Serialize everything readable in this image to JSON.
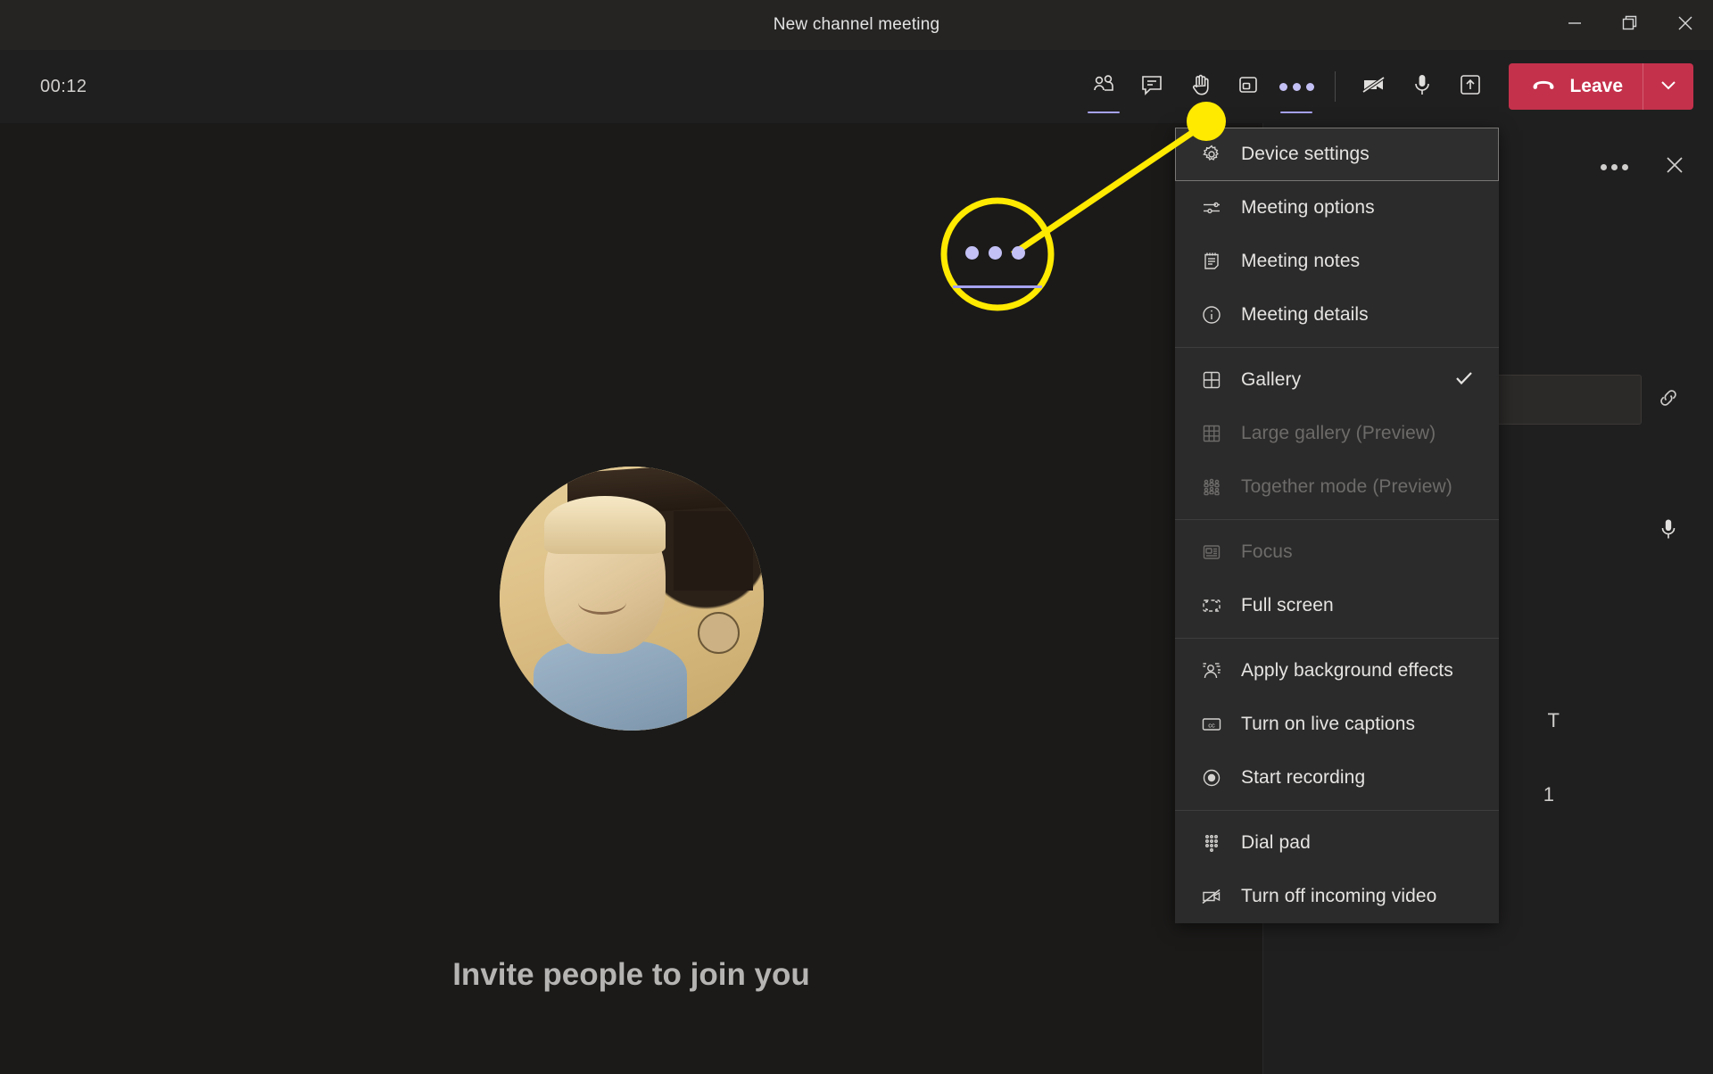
{
  "window": {
    "title": "New channel meeting",
    "controls": [
      {
        "name": "minimize",
        "glyph": "minimize-icon"
      },
      {
        "name": "restore",
        "glyph": "restore-icon"
      },
      {
        "name": "close",
        "glyph": "close-icon"
      }
    ]
  },
  "toolbar": {
    "timer": "00:12",
    "buttons": [
      {
        "name": "show-participants",
        "icon": "people-icon",
        "active": true
      },
      {
        "name": "show-conversation",
        "icon": "chat-icon",
        "active": false
      },
      {
        "name": "raise-hand",
        "icon": "hand-icon",
        "active": false
      },
      {
        "name": "breakout-rooms",
        "icon": "rooms-icon",
        "active": false
      },
      {
        "name": "more-actions",
        "icon": "ellipsis-icon",
        "active": true
      },
      {
        "name": "camera-off",
        "icon": "camera-off-icon",
        "active": false
      },
      {
        "name": "microphone",
        "icon": "microphone-icon",
        "active": false
      },
      {
        "name": "share-content",
        "icon": "share-tray-icon",
        "active": false
      }
    ],
    "leave_label": "Leave"
  },
  "stage": {
    "invite_text": "Invite people to join you",
    "avatar_name": "participant-avatar"
  },
  "right_panel": {
    "more_options": "panel-ellipsis",
    "close": "panel-close",
    "search_placeholder": "",
    "link_icon": "copy-link-icon",
    "mic_icon": "microphone-icon",
    "ghost_text_1": "T",
    "ghost_text_2": "1"
  },
  "context_menu": {
    "groups": [
      {
        "items": [
          {
            "label": "Device settings",
            "icon": "gear-icon",
            "disabled": false,
            "checked": false,
            "focused": true
          },
          {
            "label": "Meeting options",
            "icon": "sliders-icon",
            "disabled": false,
            "checked": false,
            "focused": false
          },
          {
            "label": "Meeting notes",
            "icon": "notepad-icon",
            "disabled": false,
            "checked": false,
            "focused": false
          },
          {
            "label": "Meeting details",
            "icon": "info-icon",
            "disabled": false,
            "checked": false,
            "focused": false
          }
        ]
      },
      {
        "items": [
          {
            "label": "Gallery",
            "icon": "gallery-icon",
            "disabled": false,
            "checked": true,
            "focused": false
          },
          {
            "label": "Large gallery (Preview)",
            "icon": "large-gallery-icon",
            "disabled": true,
            "checked": false,
            "focused": false
          },
          {
            "label": "Together mode (Preview)",
            "icon": "together-mode-icon",
            "disabled": true,
            "checked": false,
            "focused": false
          }
        ]
      },
      {
        "items": [
          {
            "label": "Focus",
            "icon": "focus-icon",
            "disabled": true,
            "checked": false,
            "focused": false
          },
          {
            "label": "Full screen",
            "icon": "fullscreen-icon",
            "disabled": false,
            "checked": false,
            "focused": false
          }
        ]
      },
      {
        "items": [
          {
            "label": "Apply background effects",
            "icon": "background-effects-icon",
            "disabled": false,
            "checked": false,
            "focused": false
          },
          {
            "label": "Turn on live captions",
            "icon": "closed-captions-icon",
            "disabled": false,
            "checked": false,
            "focused": false
          },
          {
            "label": "Start recording",
            "icon": "record-icon",
            "disabled": false,
            "checked": false,
            "focused": false
          }
        ]
      },
      {
        "items": [
          {
            "label": "Dial pad",
            "icon": "dialpad-icon",
            "disabled": false,
            "checked": false,
            "focused": false
          },
          {
            "label": "Turn off incoming video",
            "icon": "incoming-video-off-icon",
            "disabled": false,
            "checked": false,
            "focused": false
          }
        ]
      }
    ]
  },
  "annotation": {
    "highlight_color": "#FFEA00",
    "callout_icon": "ellipsis-icon",
    "name": "yellow-callout-annotation"
  },
  "colors": {
    "window_chrome": "#252423",
    "toolbar_bg": "#201F1F",
    "stage_bg": "#1B1A19",
    "menu_bg": "#2B2B2B",
    "leave_red": "#C4314B",
    "accent_purple": "#C3C0F5",
    "text_primary": "#E6E4E2",
    "text_disabled": "#6D6B69",
    "highlight_yellow": "#FFEA00"
  }
}
